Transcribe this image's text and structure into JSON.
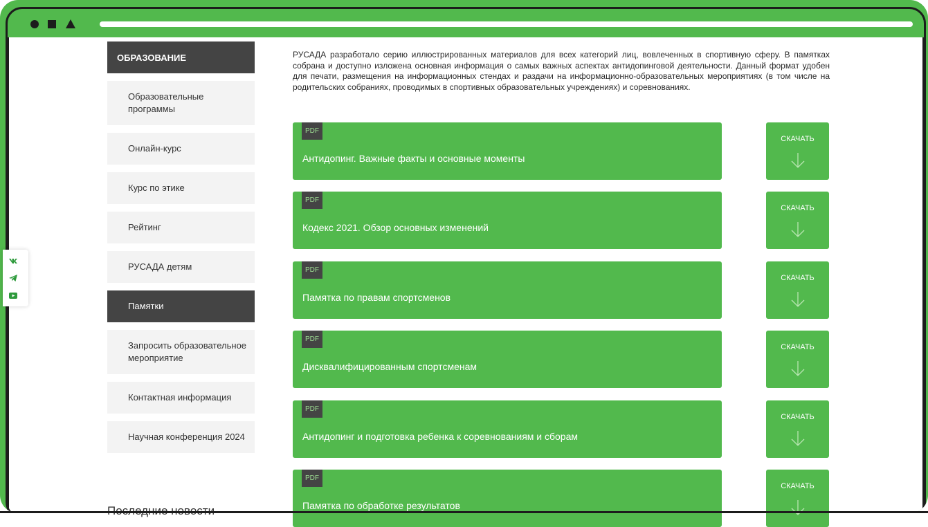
{
  "sidebar": {
    "header": "ОБРАЗОВАНИЕ",
    "items": [
      {
        "label": "Образовательные программы",
        "active": false
      },
      {
        "label": "Онлайн-курс",
        "active": false
      },
      {
        "label": "Курс по этике",
        "active": false
      },
      {
        "label": "Рейтинг",
        "active": false
      },
      {
        "label": "РУСАДА детям",
        "active": false
      },
      {
        "label": "Памятки",
        "active": true
      },
      {
        "label": "Запросить образовательное мероприятие",
        "active": false
      },
      {
        "label": "Контактная информация",
        "active": false
      },
      {
        "label": "Научная конференция 2024",
        "active": false
      }
    ],
    "news_title": "Последние новости"
  },
  "main": {
    "intro": "РУСАДА разработало серию иллюстрированных материалов для всех категорий лиц, вовлеченных в спортивную сферу. В памятках собрана и доступно изложена основная информация о самых важных аспектах антидопинговой деятельности. Данный формат удобен для печати, размещения на информационных стендах и раздачи на информационно-образовательных мероприятиях (в том числе на родительских собраниях, проводимых в спортивных образовательных учреждениях) и соревнованиях.",
    "documents": [
      {
        "badge": "PDF",
        "title": "Антидопинг. Важные факты и основные моменты",
        "download_label": "СКАЧАТЬ"
      },
      {
        "badge": "PDF",
        "title": "Кодекс 2021. Обзор основных изменений",
        "download_label": "СКАЧАТЬ"
      },
      {
        "badge": "PDF",
        "title": "Памятка по правам спортсменов",
        "download_label": "СКАЧАТЬ"
      },
      {
        "badge": "PDF",
        "title": "Дисквалифицированным спортсменам",
        "download_label": "СКАЧАТЬ"
      },
      {
        "badge": "PDF",
        "title": "Антидопинг и подготовка ребенка к соревнованиям и сборам",
        "download_label": "СКАЧАТЬ"
      },
      {
        "badge": "PDF",
        "title": "Памятка по обработке результатов",
        "download_label": "СКАЧАТЬ"
      }
    ]
  },
  "social": [
    "vk-icon",
    "telegram-icon",
    "youtube-icon"
  ],
  "colors": {
    "accent": "#52b94d",
    "dark": "#444444",
    "sidebar_bg": "#f3f3f3",
    "frame": "#1c1c1c"
  }
}
